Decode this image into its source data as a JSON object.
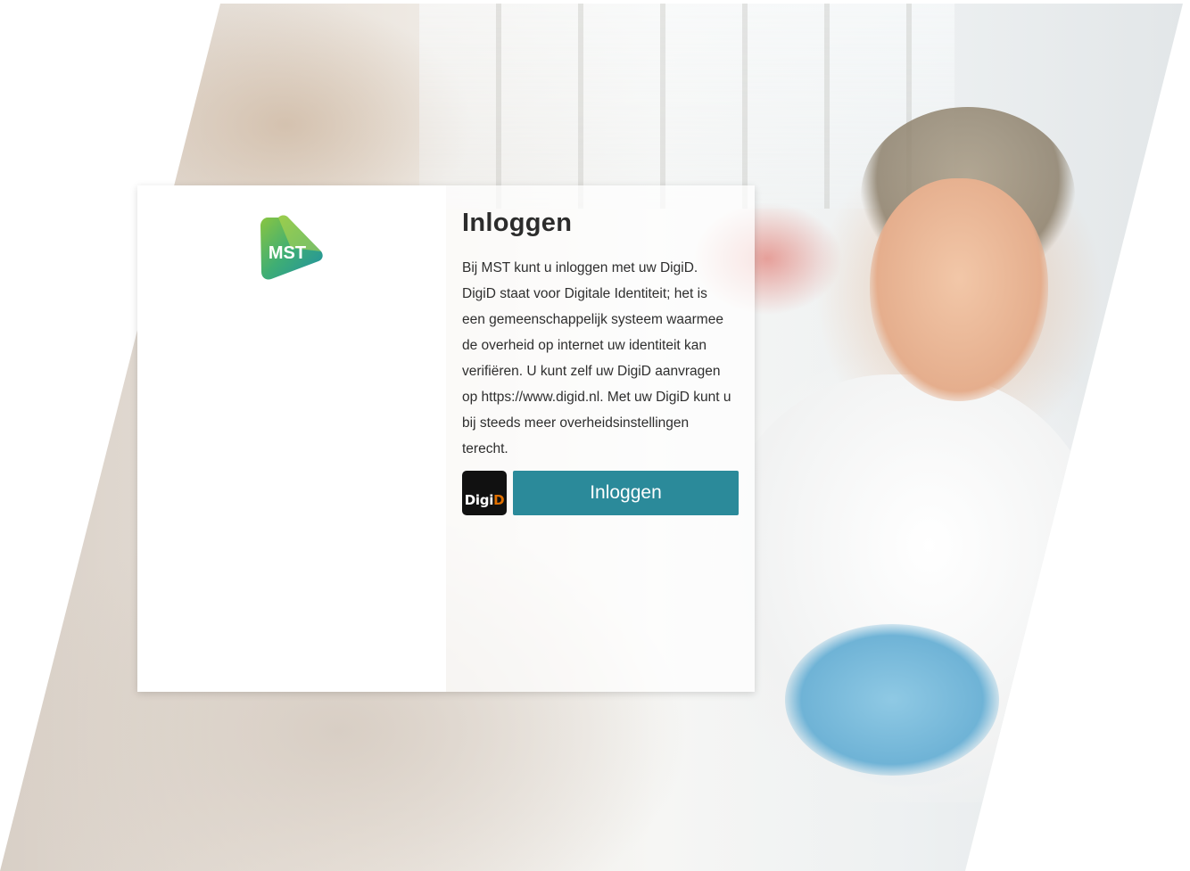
{
  "background": {
    "image": "hero-photo-nurse-with-patient"
  },
  "brand": {
    "logo_text": "MST",
    "colors": {
      "green": "#5cb85c",
      "teal": "#1f8fa3",
      "accent_button": "#2b8a9a"
    }
  },
  "login": {
    "title": "Inloggen",
    "intro": "Bij MST kunt u inloggen met uw DigiD. DigiD staat voor Digitale Identiteit; het is een gemeenschappelijk systeem waarmee de overheid op internet uw identiteit kan verifiëren. U kunt zelf uw DigiD aanvragen op https://www.digid.nl. Met uw DigiD kunt u bij steeds meer overheidsinstellingen terecht.",
    "digid_badge": {
      "part1": "Digi",
      "part2": "D",
      "colors": {
        "background": "#111111",
        "highlight": "#e17000"
      }
    },
    "button_label": "Inloggen"
  }
}
